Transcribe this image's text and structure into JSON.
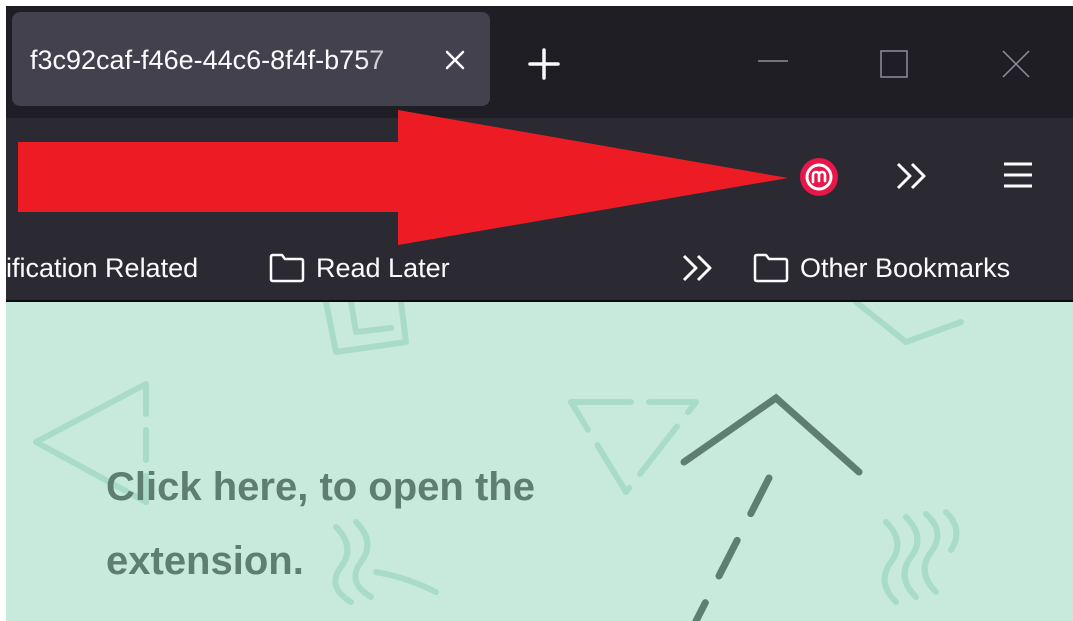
{
  "tab": {
    "title": "f3c92caf-f46e-44c6-8f4f-b757"
  },
  "bookmarks": {
    "items": [
      {
        "label": "ification Related",
        "has_folder_icon": false
      },
      {
        "label": "Read Later",
        "has_folder_icon": true
      }
    ],
    "other": {
      "label": "Other Bookmarks"
    }
  },
  "content": {
    "hint_line1": "Click here, to open the",
    "hint_line2": "extension."
  },
  "colors": {
    "annotation_arrow": "#ed1c24",
    "extension_icon": "#e8174a",
    "page_background": "#c8eadd"
  },
  "icons": {
    "extension": "m-logo-icon",
    "overflow": "chevron-double-right-icon",
    "menu": "hamburger-menu-icon",
    "folder": "folder-icon"
  }
}
